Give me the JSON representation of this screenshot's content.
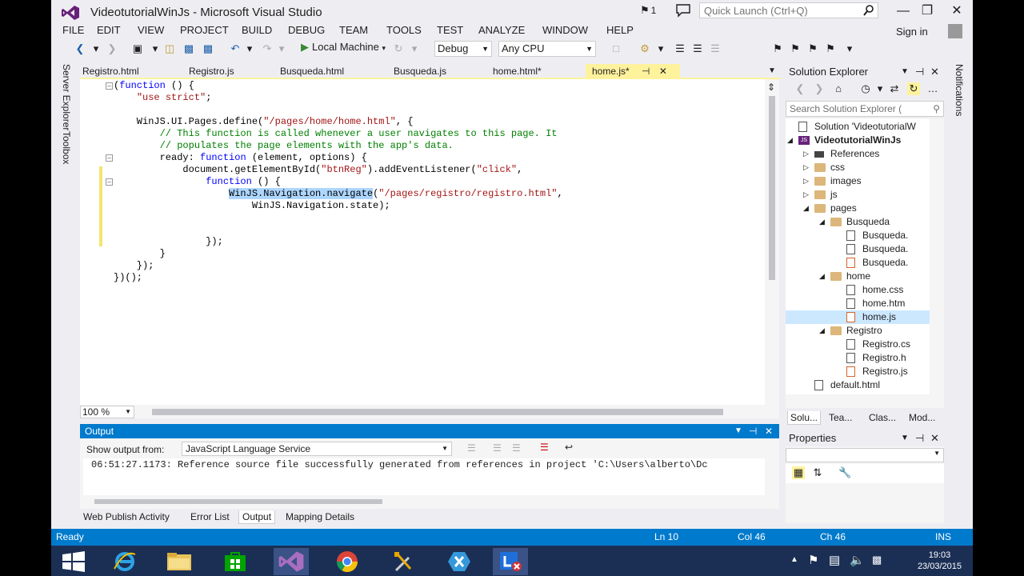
{
  "window": {
    "title": "VideotutorialWinJs - Microsoft Visual Studio",
    "notification_count": "1",
    "quick_launch_placeholder": "Quick Launch (Ctrl+Q)"
  },
  "menu": {
    "items": [
      "FILE",
      "EDIT",
      "VIEW",
      "PROJECT",
      "BUILD",
      "DEBUG",
      "TEAM",
      "TOOLS",
      "TEST",
      "ANALYZE",
      "WINDOW",
      "HELP"
    ],
    "signin": "Sign in"
  },
  "toolbar": {
    "run_label": "Local Machine",
    "config": "Debug",
    "platform": "Any CPU"
  },
  "side_tabs": {
    "server_explorer": "Server Explorer",
    "toolbox": "Toolbox",
    "notifications": "Notifications"
  },
  "doc_tabs": [
    {
      "label": "Registro.html",
      "active": false
    },
    {
      "label": "Registro.js",
      "active": false
    },
    {
      "label": "Busqueda.html",
      "active": false
    },
    {
      "label": "Busqueda.js",
      "active": false
    },
    {
      "label": "home.html*",
      "active": false
    },
    {
      "label": "home.js*",
      "active": true
    }
  ],
  "editor": {
    "zoom": "100 %",
    "lines": [
      "(function () {",
      "    \"use strict\";",
      "",
      "    WinJS.UI.Pages.define(\"/pages/home/home.html\", {",
      "        // This function is called whenever a user navigates to this page. It",
      "        // populates the page elements with the app's data.",
      "        ready: function (element, options) {",
      "            document.getElementById(\"btnReg\").addEventListener(\"click\",",
      "                function () {",
      "                    WinJS.Navigation.navigate(\"/pages/registro/registro.html\",",
      "                        WinJS.Navigation.state);",
      "",
      "",
      "                });",
      "        }",
      "    });",
      "})();"
    ]
  },
  "output": {
    "title": "Output",
    "show_from_label": "Show output from:",
    "source": "JavaScript Language Service",
    "text": "06:51:27.1173: Reference source file successfully generated from references in project 'C:\\Users\\alberto\\Dc"
  },
  "bottom_tabs": [
    {
      "label": "Web Publish Activity",
      "active": false
    },
    {
      "label": "Error List",
      "active": false
    },
    {
      "label": "Output",
      "active": true
    },
    {
      "label": "Mapping Details",
      "active": false
    }
  ],
  "solution_explorer": {
    "title": "Solution Explorer",
    "search_placeholder": "Search Solution Explorer (",
    "tree": [
      {
        "label": "Solution 'VideotutorialW",
        "level": 0,
        "icon": "solution",
        "expand": ""
      },
      {
        "label": "VideotutorialWinJs",
        "level": 0,
        "icon": "project",
        "expand": "open",
        "bold": true
      },
      {
        "label": "References",
        "level": 1,
        "icon": "references",
        "expand": "closed"
      },
      {
        "label": "css",
        "level": 1,
        "icon": "folder",
        "expand": "closed"
      },
      {
        "label": "images",
        "level": 1,
        "icon": "folder",
        "expand": "closed"
      },
      {
        "label": "js",
        "level": 1,
        "icon": "folder",
        "expand": "closed"
      },
      {
        "label": "pages",
        "level": 1,
        "icon": "folder",
        "expand": "open"
      },
      {
        "label": "Busqueda",
        "level": 2,
        "icon": "folder",
        "expand": "open"
      },
      {
        "label": "Busqueda.",
        "level": 3,
        "icon": "css-file",
        "expand": ""
      },
      {
        "label": "Busqueda.",
        "level": 3,
        "icon": "html-file",
        "expand": ""
      },
      {
        "label": "Busqueda.",
        "level": 3,
        "icon": "js-file",
        "expand": ""
      },
      {
        "label": "home",
        "level": 2,
        "icon": "folder",
        "expand": "open"
      },
      {
        "label": "home.css",
        "level": 3,
        "icon": "css-file",
        "expand": ""
      },
      {
        "label": "home.htm",
        "level": 3,
        "icon": "html-file",
        "expand": ""
      },
      {
        "label": "home.js",
        "level": 3,
        "icon": "js-file",
        "expand": "",
        "selected": true
      },
      {
        "label": "Registro",
        "level": 2,
        "icon": "folder",
        "expand": "open"
      },
      {
        "label": "Registro.cs",
        "level": 3,
        "icon": "css-file",
        "expand": ""
      },
      {
        "label": "Registro.h",
        "level": 3,
        "icon": "html-file",
        "expand": ""
      },
      {
        "label": "Registro.js",
        "level": 3,
        "icon": "js-file",
        "expand": ""
      },
      {
        "label": "default.html",
        "level": 1,
        "icon": "html-file",
        "expand": ""
      }
    ],
    "tabs": [
      "Solu...",
      "Tea...",
      "Clas...",
      "Mod..."
    ]
  },
  "properties": {
    "title": "Properties"
  },
  "statusbar": {
    "ready": "Ready",
    "line": "Ln 10",
    "col": "Col 46",
    "ch": "Ch 46",
    "mode": "INS"
  },
  "taskbar": {
    "time": "19:03",
    "date": "23/03/2015"
  },
  "colors": {
    "accent": "#007acc",
    "active_tab": "#fff29d",
    "taskbar": "#1b2f55"
  }
}
